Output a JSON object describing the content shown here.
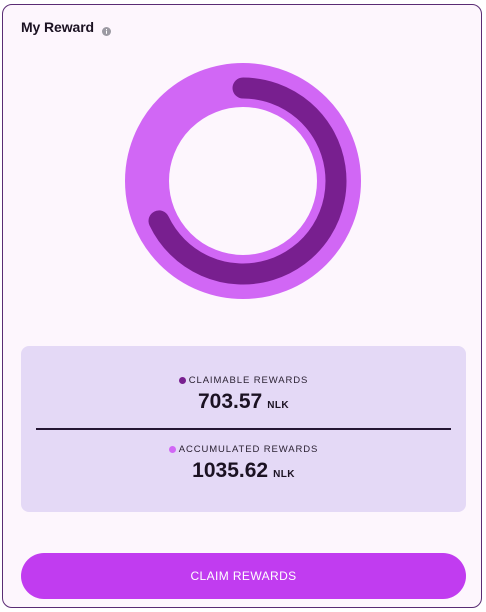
{
  "header": {
    "title": "My Reward",
    "info_icon": "info-icon"
  },
  "chart_data": {
    "type": "pie",
    "series": [
      {
        "name": "CLAIMABLE REWARDS",
        "value": 703.57,
        "color": "#781f8f"
      },
      {
        "name": "ACCUMULATED REWARDS",
        "value": 1035.62,
        "color": "#d167f5"
      }
    ]
  },
  "rewards": {
    "claimable": {
      "label": "CLAIMABLE REWARDS",
      "value": "703.57",
      "unit": "NLK",
      "dot_color": "#781f8f"
    },
    "accumulated": {
      "label": "ACCUMULATED REWARDS",
      "value": "1035.62",
      "unit": "NLK",
      "dot_color": "#d167f5"
    }
  },
  "actions": {
    "claim_label": "CLAIM REWARDS"
  },
  "colors": {
    "accent": "#c13cf0",
    "panel": "#e4d9f6",
    "card_bg": "#fdf6fd"
  }
}
